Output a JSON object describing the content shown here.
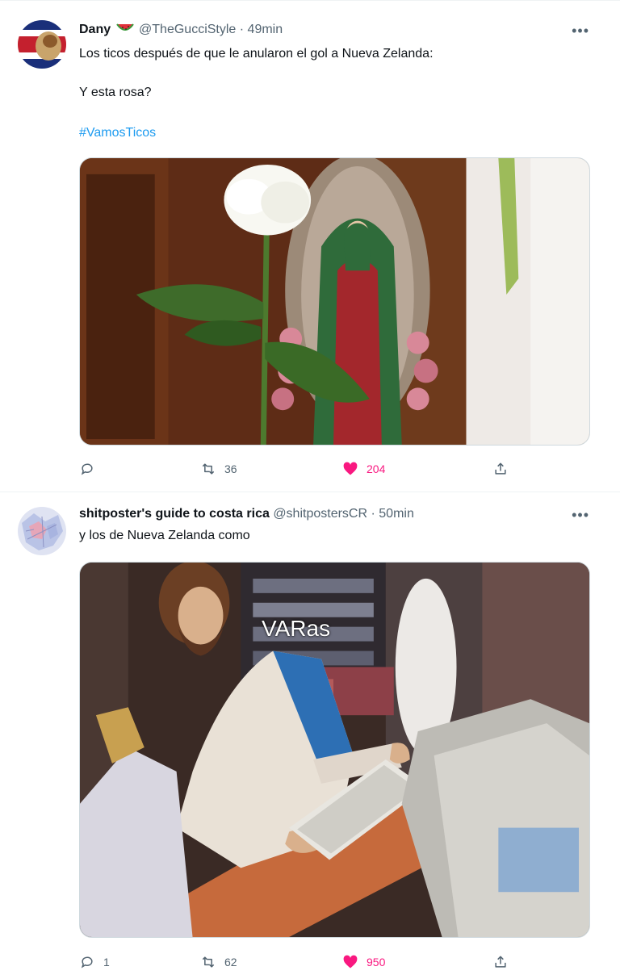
{
  "tweets": [
    {
      "display_name": "Dany",
      "handle": "@TheGucciStyle",
      "separator": "·",
      "time": "49min",
      "more_icon": "more-horizontal-icon",
      "lines": [
        "Los ticos después de que le anularon el gol a Nueva Zelanda:",
        "Y esta rosa?"
      ],
      "hashtag": "#VamosTicos",
      "actions": {
        "replies": "",
        "retweets": "36",
        "likes": "204"
      },
      "colors": {
        "like": "#f91880",
        "hashtag": "#1d9bf0"
      }
    },
    {
      "display_name": "shitposter's guide to costa rica",
      "handle": "@shitpostersCR",
      "separator": "·",
      "time": "50min",
      "more_icon": "more-horizontal-icon",
      "lines": [
        "y los de Nueva Zelanda como"
      ],
      "media_caption": "VARas",
      "actions": {
        "replies": "1",
        "retweets": "62",
        "likes": "950"
      },
      "colors": {
        "like": "#f91880"
      }
    }
  ]
}
